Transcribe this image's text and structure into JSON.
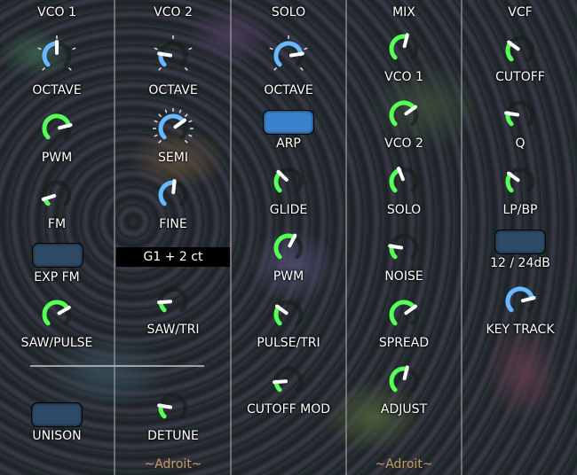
{
  "sections": [
    {
      "title": "VCO 1"
    },
    {
      "title": "VCO 2"
    },
    {
      "title": "SOLO"
    },
    {
      "title": "MIX"
    },
    {
      "title": "VCF"
    }
  ],
  "vco1": {
    "octave": {
      "label": "OCTAVE",
      "value": 0.5,
      "color": "#66b8ff"
    },
    "pwm": {
      "label": "PWM",
      "value": 0.78,
      "color": "#55ff55"
    },
    "fm": {
      "label": "FM",
      "value": 0.1,
      "color": "#55ff55"
    },
    "exp_fm": {
      "label": "EXP FM",
      "state": "off"
    },
    "saw_pulse": {
      "label": "SAW/PULSE",
      "value": 0.72,
      "color": "#55ff55"
    },
    "unison": {
      "label": "UNISON",
      "state": "off"
    }
  },
  "vco2": {
    "octave": {
      "label": "OCTAVE",
      "value": 0.2,
      "color": "#66b8ff"
    },
    "semi": {
      "label": "SEMI",
      "value": 0.7,
      "color": "#66b8ff"
    },
    "fine": {
      "label": "FINE",
      "value": 0.52,
      "color": "#66b8ff"
    },
    "readout": "G1 + 2 ct",
    "saw_tri": {
      "label": "SAW/TRI",
      "value": 0.15,
      "color": "#55ff55"
    },
    "detune": {
      "label": "DETUNE",
      "value": 0.2,
      "color": "#55ff55"
    }
  },
  "solo": {
    "octave": {
      "label": "OCTAVE",
      "value": 0.8,
      "color": "#66b8ff"
    },
    "arp": {
      "label": "ARP",
      "state": "on"
    },
    "glide": {
      "label": "GLIDE",
      "value": 0.33,
      "color": "#55ff55"
    },
    "pwm": {
      "label": "PWM",
      "value": 0.6,
      "color": "#55ff55"
    },
    "pulse_tri": {
      "label": "PULSE/TRI",
      "value": 0.3,
      "color": "#55ff55"
    },
    "cutoff_mod": {
      "label": "CUTOFF MOD",
      "value": 0.15,
      "color": "#55ff55"
    }
  },
  "mix": {
    "vco1": {
      "label": "VCO 1",
      "value": 0.55,
      "color": "#55ff55"
    },
    "vco2": {
      "label": "VCO 2",
      "value": 0.7,
      "color": "#55ff55"
    },
    "solo": {
      "label": "SOLO",
      "value": 0.42,
      "color": "#55ff55"
    },
    "noise": {
      "label": "NOISE",
      "value": 0.2,
      "color": "#55ff55"
    },
    "spread": {
      "label": "SPREAD",
      "value": 0.7,
      "color": "#55ff55"
    },
    "adjust": {
      "label": "ADJUST",
      "value": 0.55,
      "color": "#55ff55"
    }
  },
  "vcf": {
    "cutoff": {
      "label": "CUTOFF",
      "value": 0.3,
      "color": "#55ff55"
    },
    "q": {
      "label": "Q",
      "value": 0.2,
      "color": "#55ff55"
    },
    "lp_bp": {
      "label": "LP/BP",
      "value": 0.3,
      "color": "#55ff55"
    },
    "slope": {
      "label": "12 / 24dB",
      "state": "off"
    },
    "key_track": {
      "label": "KEY TRACK",
      "value": 0.78,
      "color": "#66b8ff"
    }
  },
  "branding": {
    "left": "~Adroit~",
    "right": "~Adroit~"
  }
}
